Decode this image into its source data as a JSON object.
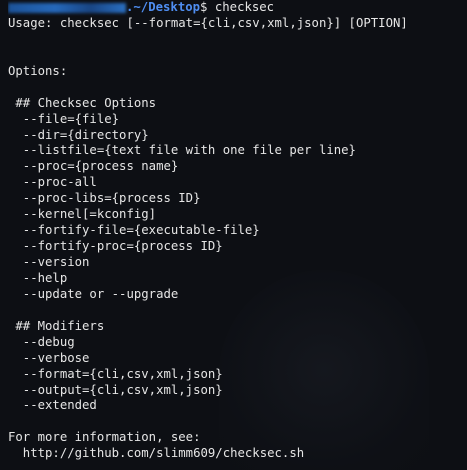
{
  "prompt": {
    "path": ".~/Desktop",
    "symbol": "$",
    "command": " checksec"
  },
  "usage_line": "Usage: checksec [--format={cli,csv,xml,json}] [OPTION]",
  "options_heading": "Options:",
  "checksec_options": {
    "heading": " ## Checksec Options",
    "items": [
      "  --file={file}",
      "  --dir={directory}",
      "  --listfile={text file with one file per line}",
      "  --proc={process name}",
      "  --proc-all",
      "  --proc-libs={process ID}",
      "  --kernel[=kconfig]",
      "  --fortify-file={executable-file}",
      "  --fortify-proc={process ID}",
      "  --version",
      "  --help",
      "  --update or --upgrade"
    ]
  },
  "modifiers": {
    "heading": " ## Modifiers",
    "items": [
      "  --debug",
      "  --verbose",
      "  --format={cli,csv,xml,json}",
      "  --output={cli,csv,xml,json}",
      "  --extended"
    ]
  },
  "footer": {
    "info": "For more information, see:",
    "url": "  http://github.com/slimm609/checksec.sh"
  },
  "colors": {
    "background": "#0d0f14",
    "text": "#e6e6e6",
    "prompt_path": "#4f8ef2"
  }
}
